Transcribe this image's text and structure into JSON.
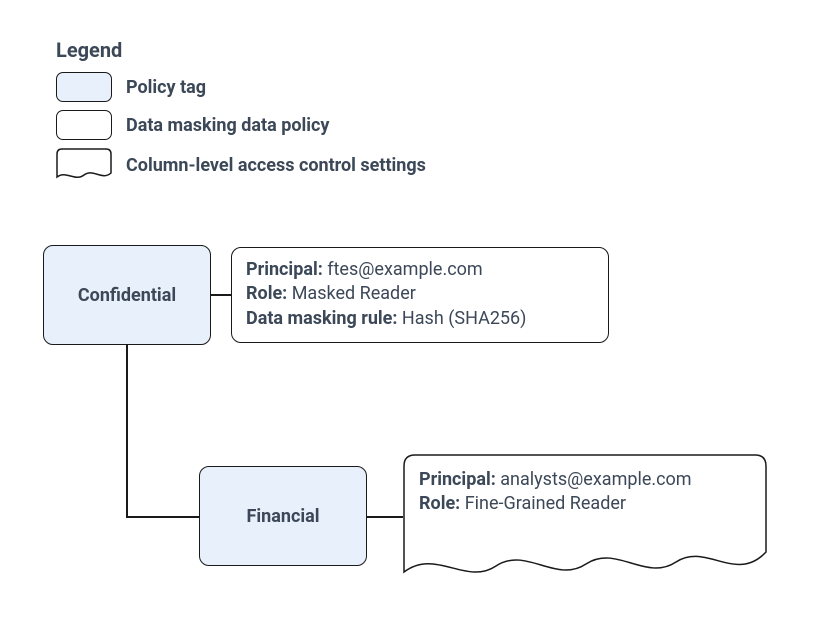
{
  "legend": {
    "title": "Legend",
    "items": {
      "policy_tag": "Policy tag",
      "data_masking_policy": "Data masking data policy",
      "clac_settings": "Column-level access control settings"
    }
  },
  "nodes": {
    "confidential": {
      "label": "Confidential",
      "policy": {
        "principal_label": "Principal:",
        "principal_value": "ftes@example.com",
        "role_label": "Role:",
        "role_value": "Masked Reader",
        "rule_label": "Data masking rule:",
        "rule_value": "Hash (SHA256)"
      }
    },
    "financial": {
      "label": "Financial",
      "policy": {
        "principal_label": "Principal:",
        "principal_value": "analysts@example.com",
        "role_label": "Role:",
        "role_value": "Fine-Grained Reader"
      }
    }
  }
}
